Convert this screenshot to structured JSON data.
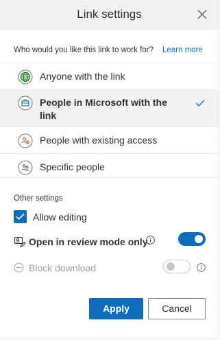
{
  "dialog": {
    "title": "Link settings",
    "question": "Who would you like this link to work for?",
    "learn_more": "Learn more"
  },
  "options": [
    {
      "label": "Anyone with the link",
      "icon": "globe-icon",
      "selected": false
    },
    {
      "label": "People in Microsoft with the link",
      "icon": "building-icon",
      "selected": true
    },
    {
      "label": "People with existing access",
      "icon": "people-access-icon",
      "selected": false
    },
    {
      "label": "Specific people",
      "icon": "specific-people-icon",
      "selected": false
    }
  ],
  "other_settings": {
    "title": "Other settings",
    "allow_editing": {
      "label": "Allow editing",
      "checked": true
    },
    "review_mode": {
      "label": "Open in review mode only",
      "on": true
    },
    "block_download": {
      "label": "Block download",
      "on": false,
      "disabled": true
    }
  },
  "buttons": {
    "apply": "Apply",
    "cancel": "Cancel"
  },
  "colors": {
    "accent": "#0f6cbd",
    "globe": "#107c10",
    "building": "#0f6cbd",
    "people_access": "#b05b2b",
    "header_bg": "#f3f2f1"
  }
}
